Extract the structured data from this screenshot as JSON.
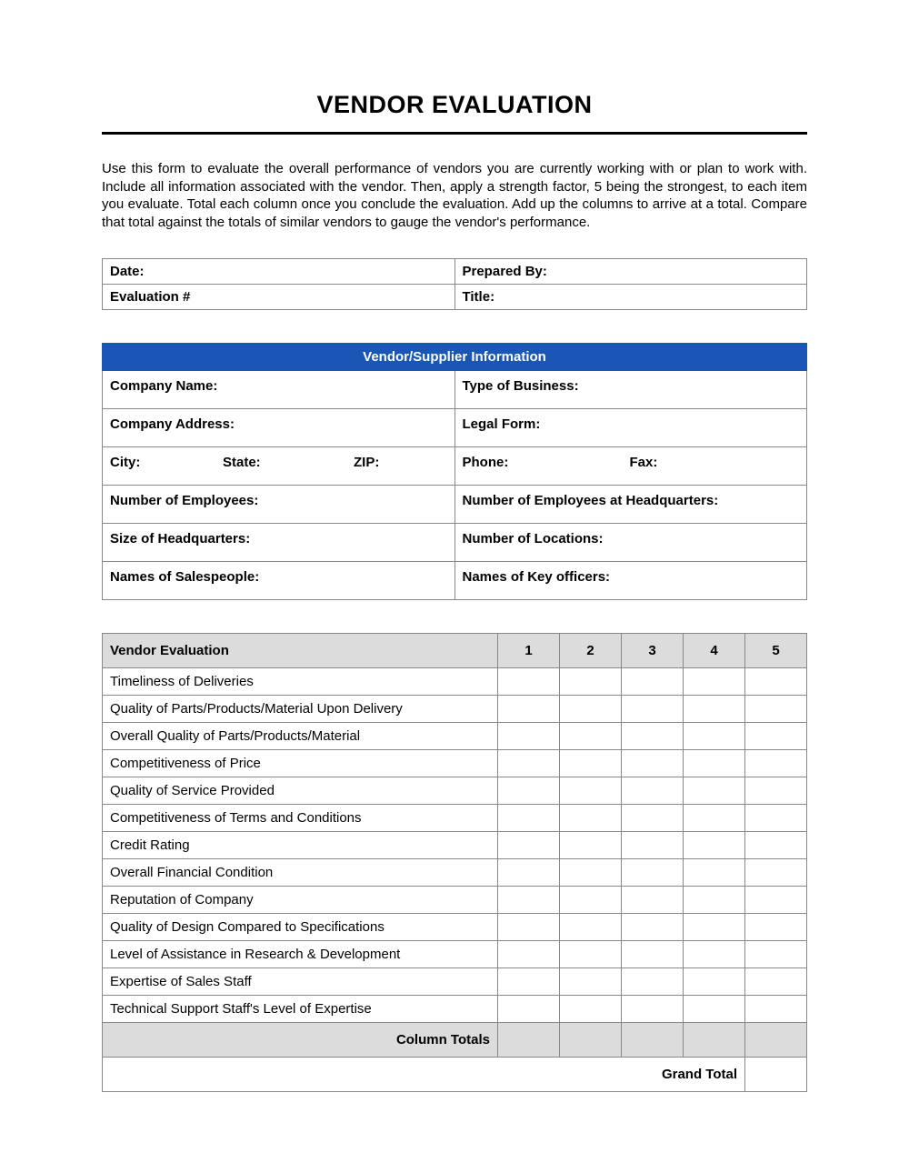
{
  "title": "VENDOR EVALUATION",
  "intro": "Use this form to evaluate the overall performance of vendors you are currently working with or plan to work with. Include all information associated with the vendor. Then, apply a strength factor, 5 being the strongest, to each item you evaluate. Total each column once you conclude the evaluation. Add up the columns to arrive at a total. Compare that total against the totals of similar vendors to gauge the vendor's performance.",
  "meta": {
    "date_label": "Date:",
    "prepared_by_label": "Prepared By:",
    "evaluation_no_label": "Evaluation #",
    "title_label": "Title:"
  },
  "vendor_info": {
    "header": "Vendor/Supplier Information",
    "company_name_label": "Company Name:",
    "type_of_business_label": "Type of Business:",
    "company_address_label": "Company Address:",
    "legal_form_label": "Legal Form:",
    "city_label": "City:",
    "state_label": "State:",
    "zip_label": "ZIP:",
    "phone_label": "Phone:",
    "fax_label": "Fax:",
    "num_employees_label": "Number of Employees:",
    "num_employees_hq_label": "Number of Employees at Headquarters:",
    "size_hq_label": "Size of Headquarters:",
    "num_locations_label": "Number of Locations:",
    "salespeople_label": "Names of Salespeople:",
    "key_officers_label": "Names of Key officers:"
  },
  "evaluation": {
    "header": "Vendor Evaluation",
    "cols": [
      "1",
      "2",
      "3",
      "4",
      "5"
    ],
    "rows": [
      "Timeliness of Deliveries",
      "Quality of Parts/Products/Material Upon Delivery",
      "Overall Quality of Parts/Products/Material",
      "Competitiveness of Price",
      "Quality of Service Provided",
      "Competitiveness of Terms and Conditions",
      "Credit Rating",
      "Overall Financial Condition",
      "Reputation of Company",
      "Quality of Design Compared to Specifications",
      "Level of Assistance in Research & Development",
      "Expertise of Sales Staff",
      "Technical Support Staff's Level of Expertise"
    ],
    "column_totals_label": "Column Totals",
    "grand_total_label": "Grand Total"
  }
}
